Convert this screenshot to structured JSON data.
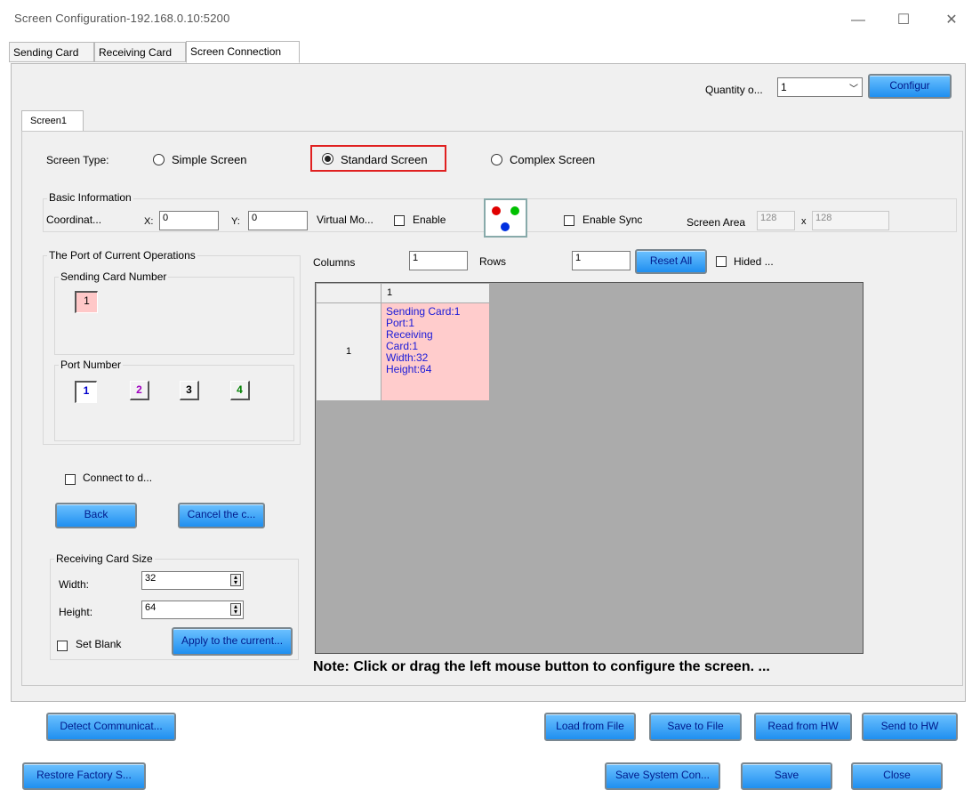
{
  "window": {
    "title": "Screen Configuration-192.168.0.10:5200",
    "minimize": "—",
    "maximize": "☐",
    "close": "✕"
  },
  "tabs": [
    {
      "label": "Sending Card"
    },
    {
      "label": "Receiving Card"
    },
    {
      "label": "Screen Connection"
    }
  ],
  "quantity": {
    "label": "Quantity o...",
    "value": "1",
    "configure_label": "Configur"
  },
  "screen_tab": {
    "label": "Screen1"
  },
  "screen_type": {
    "label": "Screen Type:",
    "options": [
      "Simple Screen",
      "Standard Screen",
      "Complex Screen"
    ],
    "selected": "Standard Screen"
  },
  "basic_info": {
    "title": "Basic Information",
    "coordinate_label": "Coordinat...",
    "x_label": "X:",
    "x_value": "0",
    "y_label": "Y:",
    "y_value": "0",
    "virtual_label": "Virtual Mo...",
    "enable_label": "Enable",
    "enable_sync_label": "Enable Sync",
    "screen_area_label": "Screen Area",
    "area_w": "128",
    "area_x": "x",
    "area_h": "128"
  },
  "port_ops": {
    "title": "The Port of Current Operations",
    "sending_card_title": "Sending Card Number",
    "sending_card_value": "1",
    "port_number_title": "Port Number",
    "ports": [
      {
        "label": "1",
        "color": "#0000cc"
      },
      {
        "label": "2",
        "color": "#a000c0"
      },
      {
        "label": "3",
        "color": "#000000"
      },
      {
        "label": "4",
        "color": "#008000"
      }
    ]
  },
  "connect_label": "Connect to d...",
  "back_label": "Back",
  "cancel_label": "Cancel the c...",
  "rcv_size": {
    "title": "Receiving Card Size",
    "width_label": "Width:",
    "width_value": "32",
    "height_label": "Height:",
    "height_value": "64",
    "set_blank_label": "Set Blank",
    "apply_label": "Apply to the current..."
  },
  "grid_controls": {
    "columns_label": "Columns",
    "columns_value": "1",
    "rows_label": "Rows",
    "rows_value": "1",
    "reset_label": "Reset All",
    "hided_label": "Hided ..."
  },
  "grid": {
    "col_header": "1",
    "row_header": "1",
    "cell_lines": [
      "Sending Card:1",
      "Port:1",
      "Receiving",
      "Card:1",
      "Width:32",
      "Height:64"
    ]
  },
  "note": "Note: Click or drag the left mouse button to configure the screen. ...",
  "bottom": {
    "detect_label": "Detect Communicat...",
    "load_label": "Load from File",
    "save_file_label": "Save to File",
    "read_hw_label": "Read from HW",
    "send_hw_label": "Send to HW",
    "restore_label": "Restore Factory S...",
    "save_sys_label": "Save System Con...",
    "save_label": "Save",
    "close_label": "Close"
  }
}
